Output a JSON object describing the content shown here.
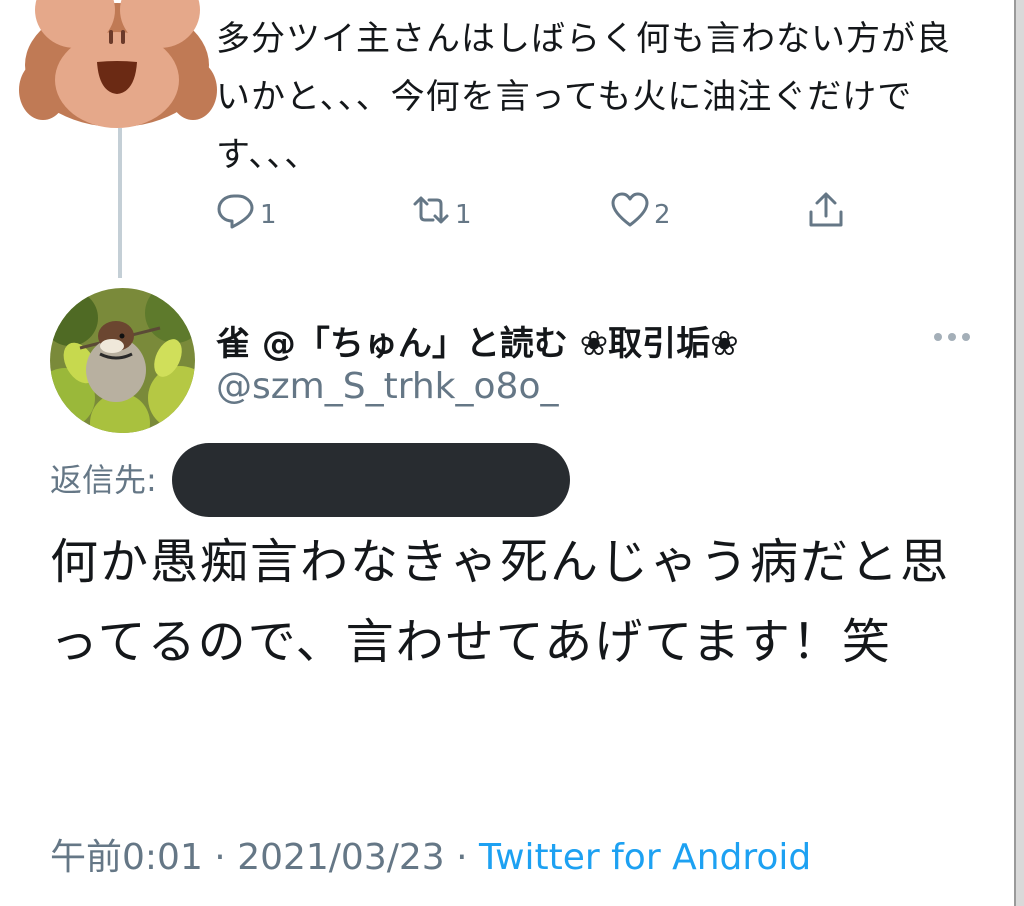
{
  "parent_tweet": {
    "avatar_icon": "see-no-evil-monkey-emoji",
    "text": "多分ツイ主さんはしばらく何も言わない方が良いかと、、、今何を言っても火に油注ぐだけです、、、",
    "actions": {
      "reply_count": "1",
      "retweet_count": "1",
      "like_count": "2",
      "share_icon": "share-icon"
    }
  },
  "tweet": {
    "display_name": "雀 @「ちゅん」と読む ❀取引垢❀",
    "handle": "@szm_S_trhk_o8o_",
    "reply_to_label": "返信先:",
    "text": "何か愚痴言わなきゃ死んじゃう病だと思ってるので、言わせてあげてます！笑",
    "time": "午前0:01",
    "separator": " · ",
    "date": "2021/03/23",
    "source": "Twitter for Android"
  },
  "colors": {
    "text": "#14171a",
    "secondary": "#657786",
    "link": "#1da1f2",
    "thread_line": "#c4cfd6",
    "redaction": "#282c30"
  }
}
